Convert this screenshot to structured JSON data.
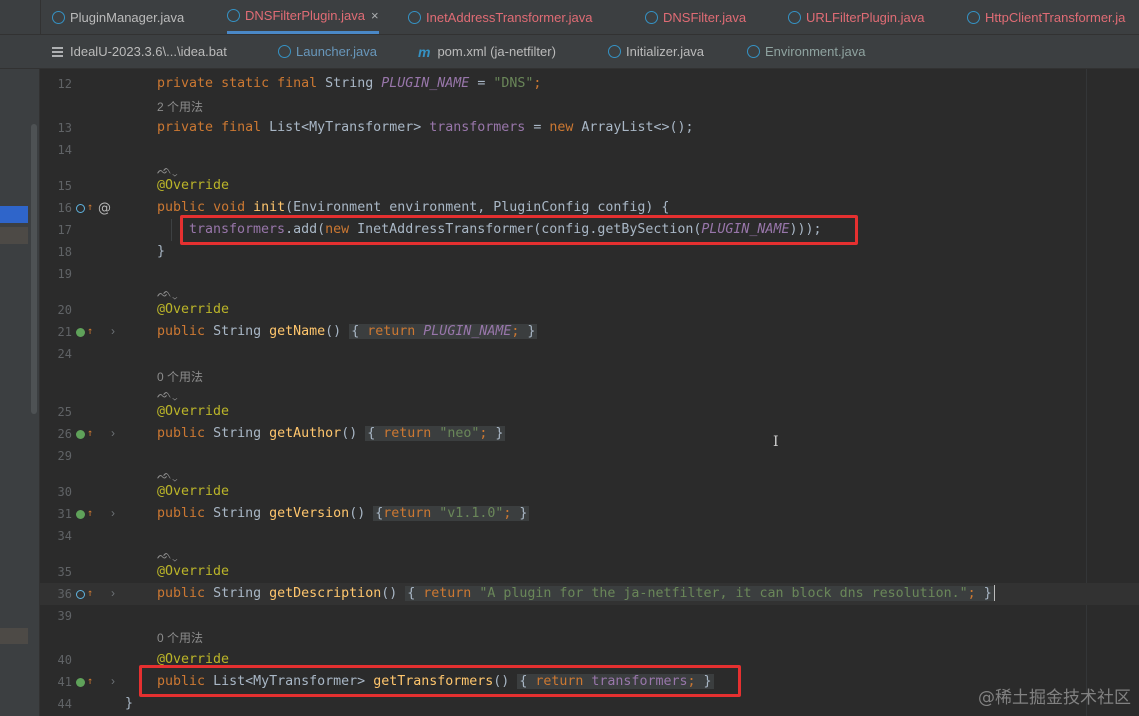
{
  "tabs_row1": [
    {
      "label": "PluginManager.java",
      "color": "#bbbbbb"
    },
    {
      "label": "DNSFilterPlugin.java",
      "color": "#e06c75",
      "active": true
    },
    {
      "label": "InetAddressTransformer.java",
      "color": "#e06c75"
    },
    {
      "label": "DNSFilter.java",
      "color": "#e06c75"
    },
    {
      "label": "URLFilterPlugin.java",
      "color": "#e06c75"
    },
    {
      "label": "HttpClientTransformer.ja",
      "color": "#e06c75"
    }
  ],
  "tabs_row2": [
    {
      "label": "IdealU-2023.3.6\\...\\idea.bat",
      "icon": "bat"
    },
    {
      "label": "Launcher.java",
      "icon": "class"
    },
    {
      "label": "pom.xml (ja-netfilter)",
      "icon": "maven"
    },
    {
      "label": "Initializer.java",
      "icon": "class"
    },
    {
      "label": "Environment.java",
      "icon": "class"
    }
  ],
  "close_glyph": "×",
  "hints": {
    "usages_2": "2 个用法",
    "usages_0": "0 个用法",
    "ai_glyph": "ᨒ",
    "ai_chevron": "⌄"
  },
  "line_numbers": [
    "12",
    "13",
    "14",
    "15",
    "16",
    "17",
    "18",
    "19",
    "20",
    "21",
    "24",
    "25",
    "26",
    "29",
    "30",
    "31",
    "34",
    "35",
    "36",
    "39",
    "40",
    "41",
    "44"
  ],
  "code": {
    "l12": [
      "private",
      "static",
      "final",
      "String",
      "PLUGIN_NAME",
      "=",
      "\"DNS\"",
      ";"
    ],
    "l13": [
      "private",
      "final",
      "List<MyTransformer>",
      "transformers",
      "=",
      "new",
      "ArrayList<>();"
    ],
    "override": "@Override",
    "l16": [
      "public",
      "void",
      "init",
      "(Environment environment, PluginConfig config) {"
    ],
    "l17": [
      "transformers",
      ".add(",
      "new",
      "InetAddressTransformer(config.getBySection(",
      "PLUGIN_NAME",
      ")));"
    ],
    "l18": "}",
    "l21": [
      "public",
      "String",
      "getName",
      "()",
      "{",
      "return",
      "PLUGIN_NAME",
      ";",
      "}"
    ],
    "l26": [
      "public",
      "String",
      "getAuthor",
      "()",
      "{",
      "return",
      "\"neo\"",
      ";",
      "}"
    ],
    "l31": [
      "public",
      "String",
      "getVersion",
      "()",
      "{",
      "return",
      "\"v1.1.0\"",
      ";",
      "}"
    ],
    "l36": [
      "public",
      "String",
      "getDescription",
      "()",
      "{",
      "return",
      "\"A plugin for the ja-netfilter, it can block dns resolution.\"",
      ";",
      "}"
    ],
    "l41": [
      "public",
      "List<MyTransformer>",
      "getTransformers",
      "()",
      "{",
      "return",
      "transformers",
      ";",
      "}"
    ],
    "l44": "}"
  },
  "gutter_at": "@",
  "fold_glyph": "›",
  "ibeam_glyph": "I",
  "watermark": "@稀土掘金技术社区",
  "colors": {
    "keyword": "#cc7832",
    "string": "#6a8759",
    "constant": "#9876aa",
    "method": "#ffc66d",
    "annotation": "#bbb529",
    "highlight_box": "#e53030"
  }
}
